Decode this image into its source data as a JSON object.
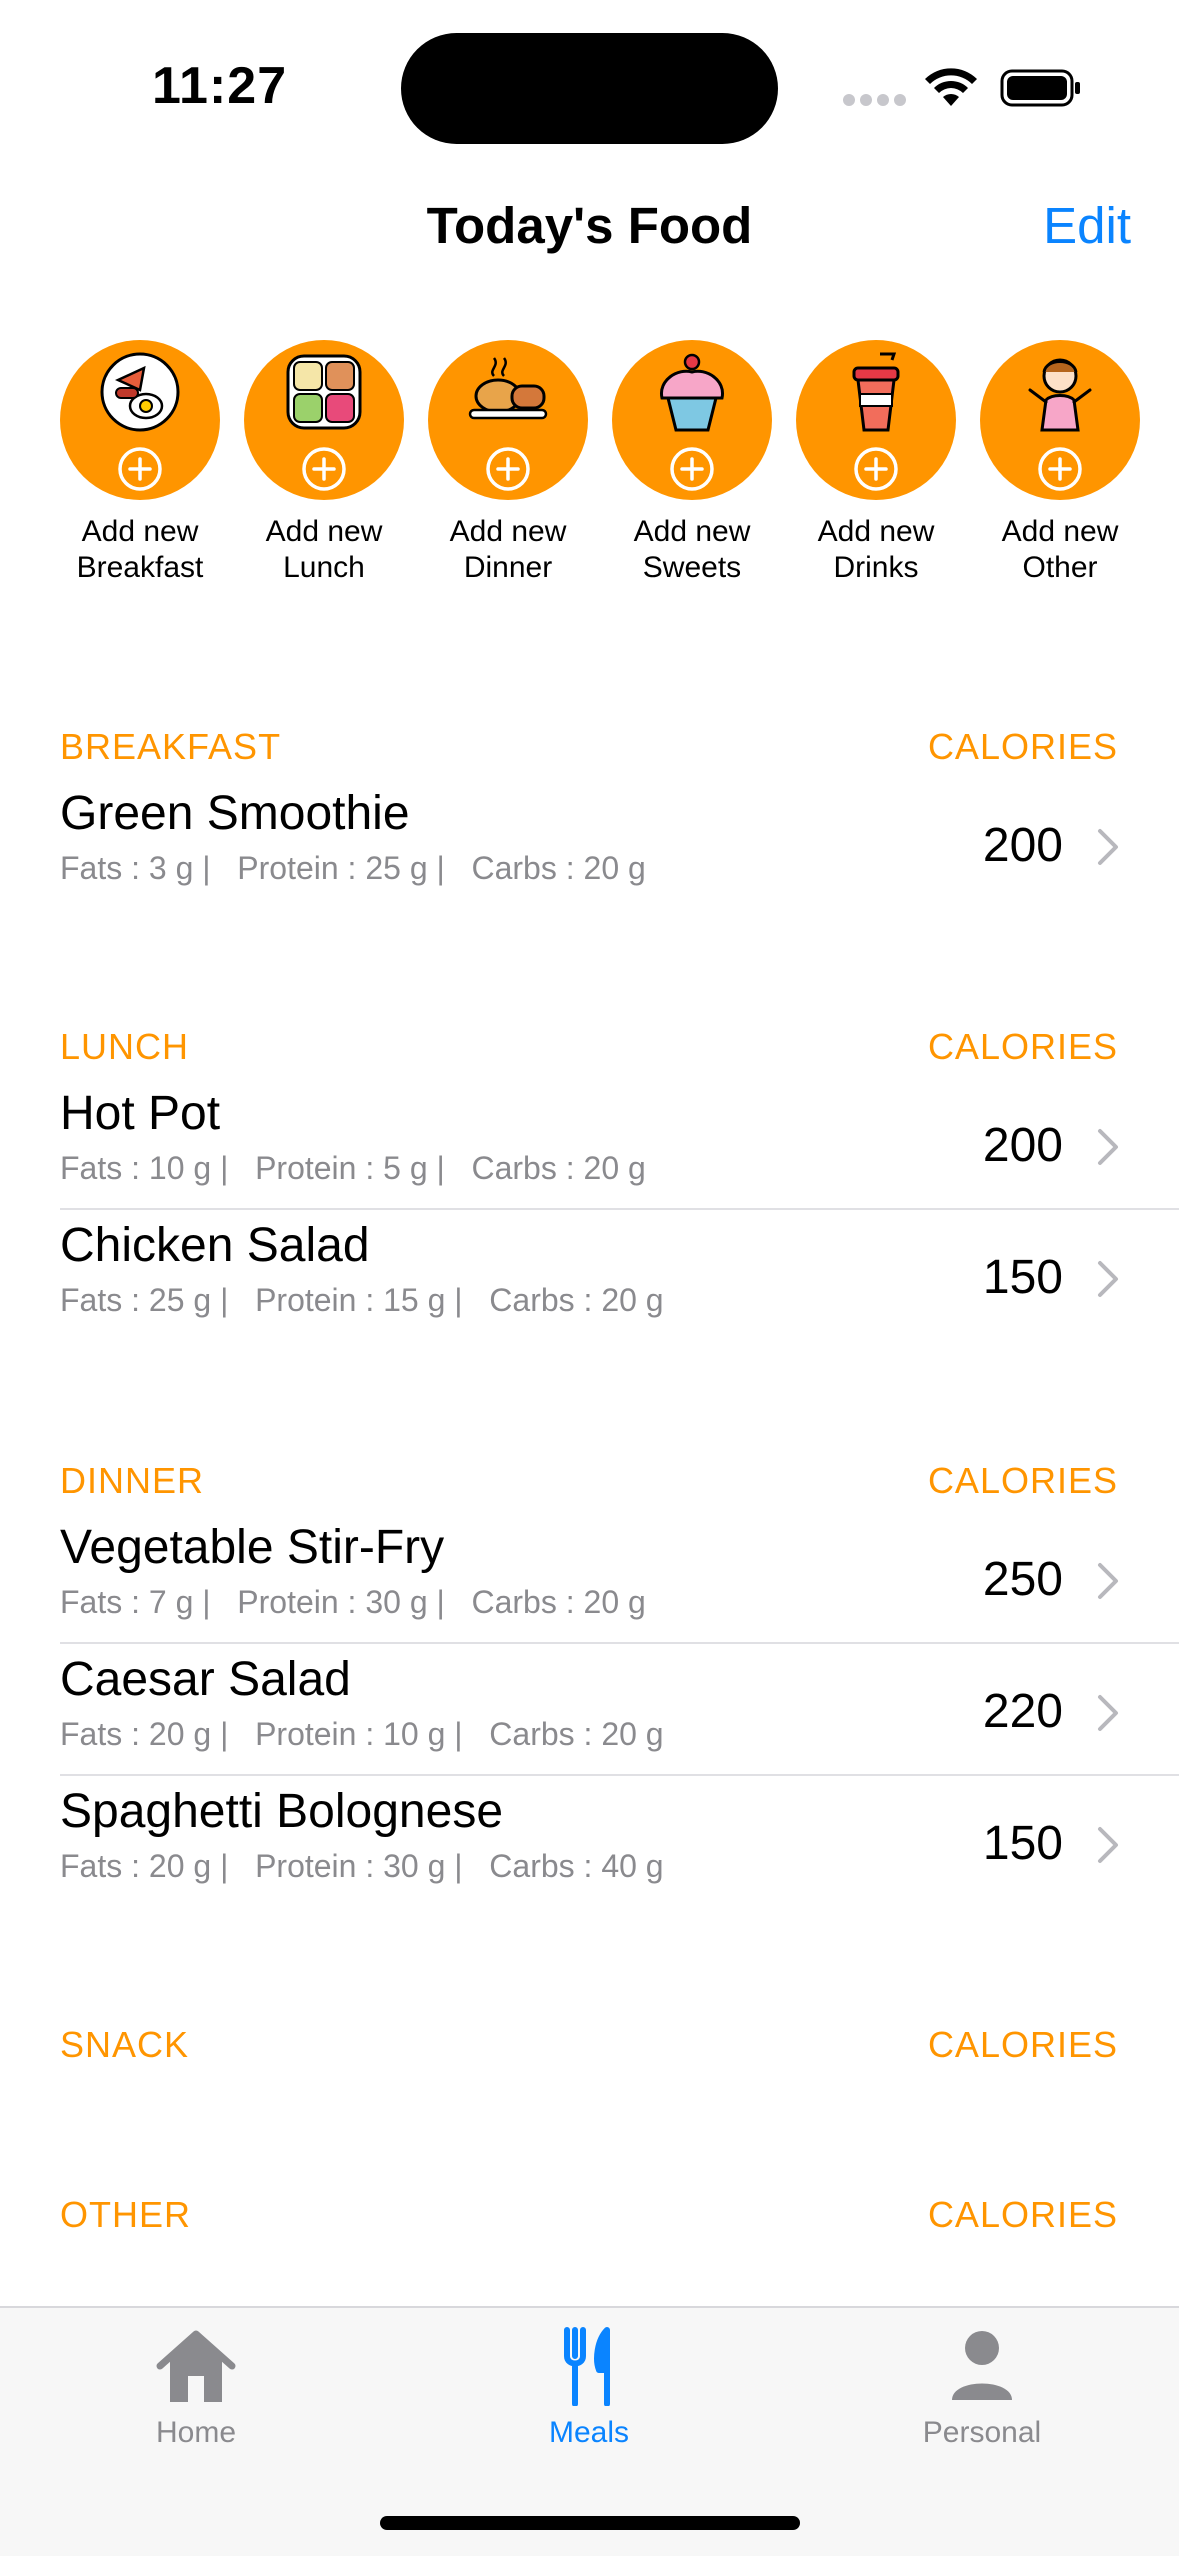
{
  "status_bar": {
    "time": "11:27"
  },
  "nav": {
    "title": "Today's Food",
    "edit_label": "Edit"
  },
  "quick_add": [
    {
      "label": "Add new\nBreakfast",
      "icon": "breakfast-plate-icon"
    },
    {
      "label": "Add new\nLunch",
      "icon": "lunch-box-icon"
    },
    {
      "label": "Add new\nDinner",
      "icon": "dinner-chicken-icon"
    },
    {
      "label": "Add new\nSweets",
      "icon": "cupcake-icon"
    },
    {
      "label": "Add new\nDrinks",
      "icon": "drink-cup-icon"
    },
    {
      "label": "Add new\nOther",
      "icon": "person-shrug-icon"
    }
  ],
  "sections": [
    {
      "title": "BREAKFAST",
      "calories_label": "CALORIES",
      "items": [
        {
          "name": "Green Smoothie",
          "macros": "Fats : 3 g |   Protein : 25 g |   Carbs : 20 g",
          "calories": "200"
        }
      ]
    },
    {
      "title": "LUNCH",
      "calories_label": "CALORIES",
      "items": [
        {
          "name": "Hot Pot",
          "macros": "Fats : 10 g |   Protein : 5 g |   Carbs : 20 g",
          "calories": "200"
        },
        {
          "name": "Chicken Salad",
          "macros": "Fats : 25 g |   Protein : 15 g |   Carbs : 20 g",
          "calories": "150"
        }
      ]
    },
    {
      "title": "DINNER",
      "calories_label": "CALORIES",
      "items": [
        {
          "name": "Vegetable Stir-Fry",
          "macros": "Fats : 7 g |   Protein : 30 g |   Carbs : 20 g",
          "calories": "250"
        },
        {
          "name": "Caesar Salad",
          "macros": "Fats : 20 g |   Protein : 10 g |   Carbs : 20 g",
          "calories": "220"
        },
        {
          "name": "Spaghetti Bolognese",
          "macros": "Fats : 20 g |   Protein : 30 g |   Carbs : 40 g",
          "calories": "150"
        }
      ]
    },
    {
      "title": "SNACK",
      "calories_label": "CALORIES",
      "items": []
    },
    {
      "title": "OTHER",
      "calories_label": "CALORIES",
      "items": []
    }
  ],
  "tabs": [
    {
      "label": "Home",
      "icon": "house-icon",
      "active": false
    },
    {
      "label": "Meals",
      "icon": "fork-knife-icon",
      "active": true
    },
    {
      "label": "Personal",
      "icon": "person-icon",
      "active": false
    }
  ],
  "colors": {
    "accent": "#ff9500",
    "link": "#0a84ff",
    "secondary_text": "#8a8a8e"
  }
}
